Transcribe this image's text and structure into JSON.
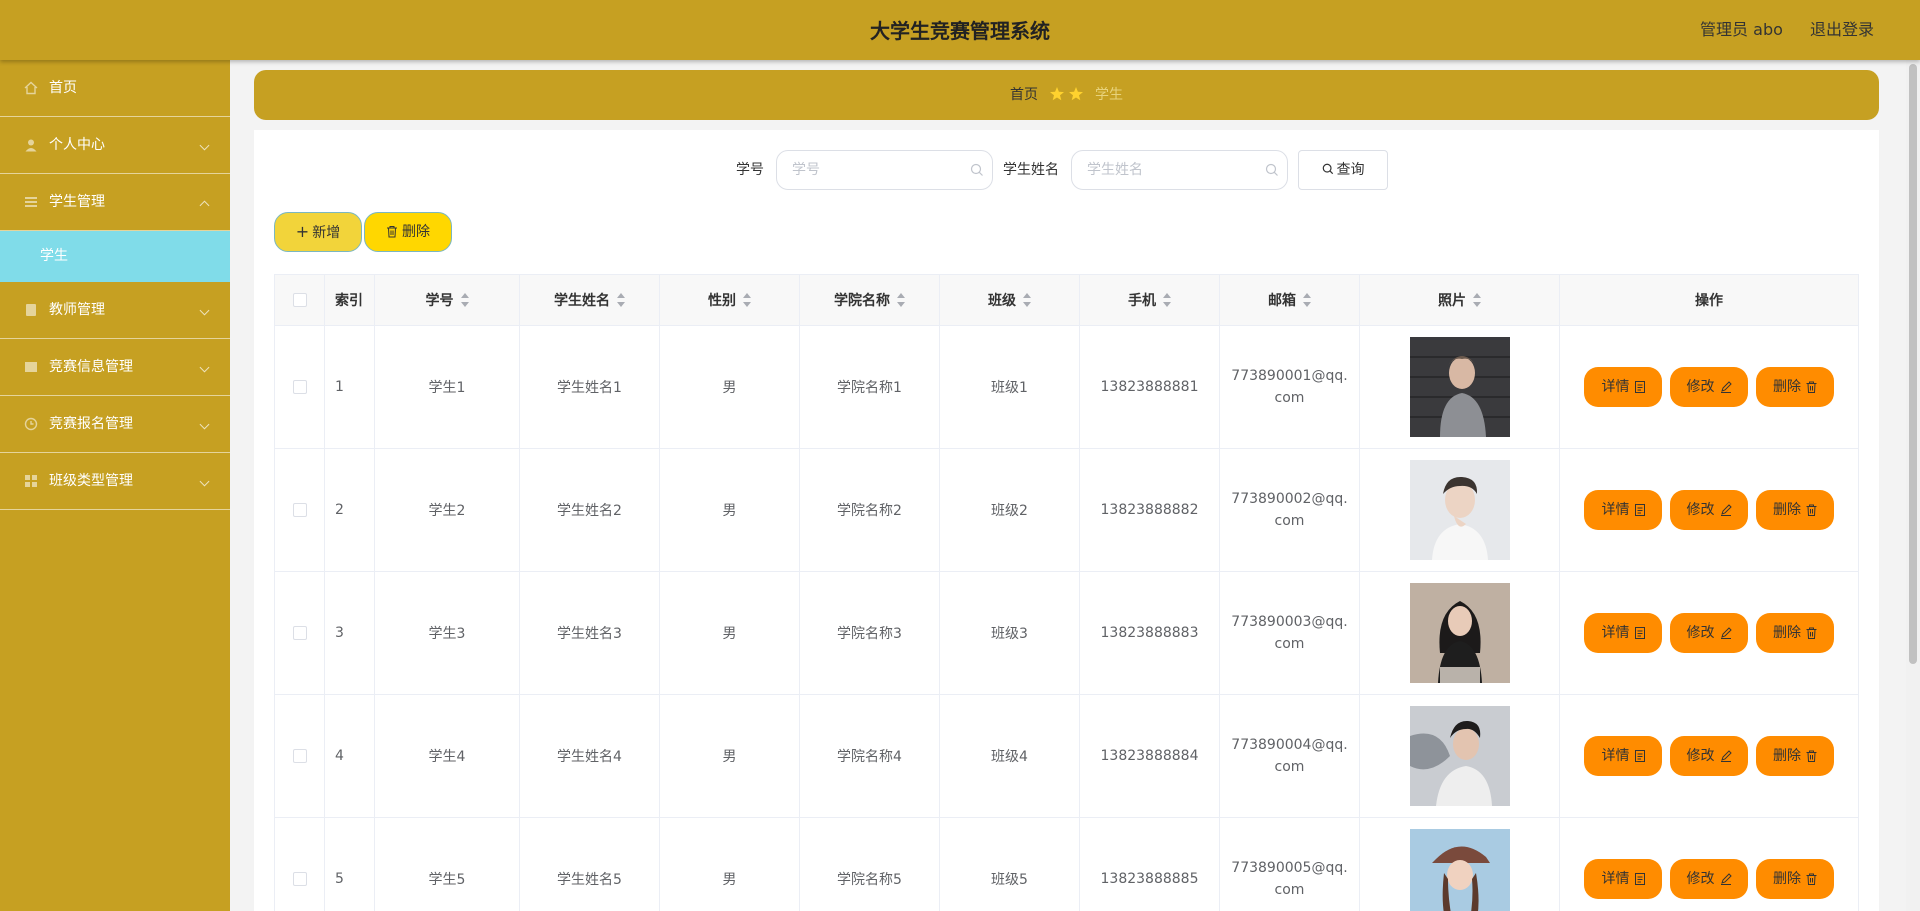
{
  "header": {
    "title": "大学生竞赛管理系统",
    "user": "管理员 abo",
    "logout": "退出登录"
  },
  "sidebar": {
    "items": [
      {
        "label": "首页",
        "icon": "home-icon"
      },
      {
        "label": "个人中心",
        "icon": "user-icon"
      },
      {
        "label": "学生管理",
        "icon": "list-icon"
      },
      {
        "label": "教师管理",
        "icon": "document-icon"
      },
      {
        "label": "竞赛信息管理",
        "icon": "grid-icon"
      },
      {
        "label": "竞赛报名管理",
        "icon": "clock-icon"
      },
      {
        "label": "班级类型管理",
        "icon": "apps-icon"
      }
    ],
    "sub_item": "学生"
  },
  "breadcrumb": {
    "home": "首页",
    "current": "学生"
  },
  "search": {
    "student_no_label": "学号",
    "student_no_placeholder": "学号",
    "student_name_label": "学生姓名",
    "student_name_placeholder": "学生姓名",
    "query_button": "查询"
  },
  "actions": {
    "add": "新增",
    "delete": "删除"
  },
  "table": {
    "columns": [
      "索引",
      "学号",
      "学生姓名",
      "性别",
      "学院名称",
      "班级",
      "手机",
      "邮箱",
      "照片",
      "操作"
    ],
    "rows": [
      {
        "index": "1",
        "student_no": "学生1",
        "name": "学生姓名1",
        "gender": "男",
        "college": "学院名称1",
        "class": "班级1",
        "phone": "13823888881",
        "email": "773890001@qq.com"
      },
      {
        "index": "2",
        "student_no": "学生2",
        "name": "学生姓名2",
        "gender": "男",
        "college": "学院名称2",
        "class": "班级2",
        "phone": "13823888882",
        "email": "773890002@qq.com"
      },
      {
        "index": "3",
        "student_no": "学生3",
        "name": "学生姓名3",
        "gender": "男",
        "college": "学院名称3",
        "class": "班级3",
        "phone": "13823888883",
        "email": "773890003@qq.com"
      },
      {
        "index": "4",
        "student_no": "学生4",
        "name": "学生姓名4",
        "gender": "男",
        "college": "学院名称4",
        "class": "班级4",
        "phone": "13823888884",
        "email": "773890004@qq.com"
      },
      {
        "index": "5",
        "student_no": "学生5",
        "name": "学生姓名5",
        "gender": "男",
        "college": "学院名称5",
        "class": "班级5",
        "phone": "13823888885",
        "email": "773890005@qq.com"
      }
    ],
    "op_labels": {
      "detail": "详情",
      "edit": "修改",
      "delete": "删除"
    }
  },
  "colors": {
    "accent": "#c6a022",
    "submenu_active": "#80dce9",
    "op_button": "#ff8c00",
    "add_button": "#f2d43a",
    "delete_button": "#ffd700"
  }
}
